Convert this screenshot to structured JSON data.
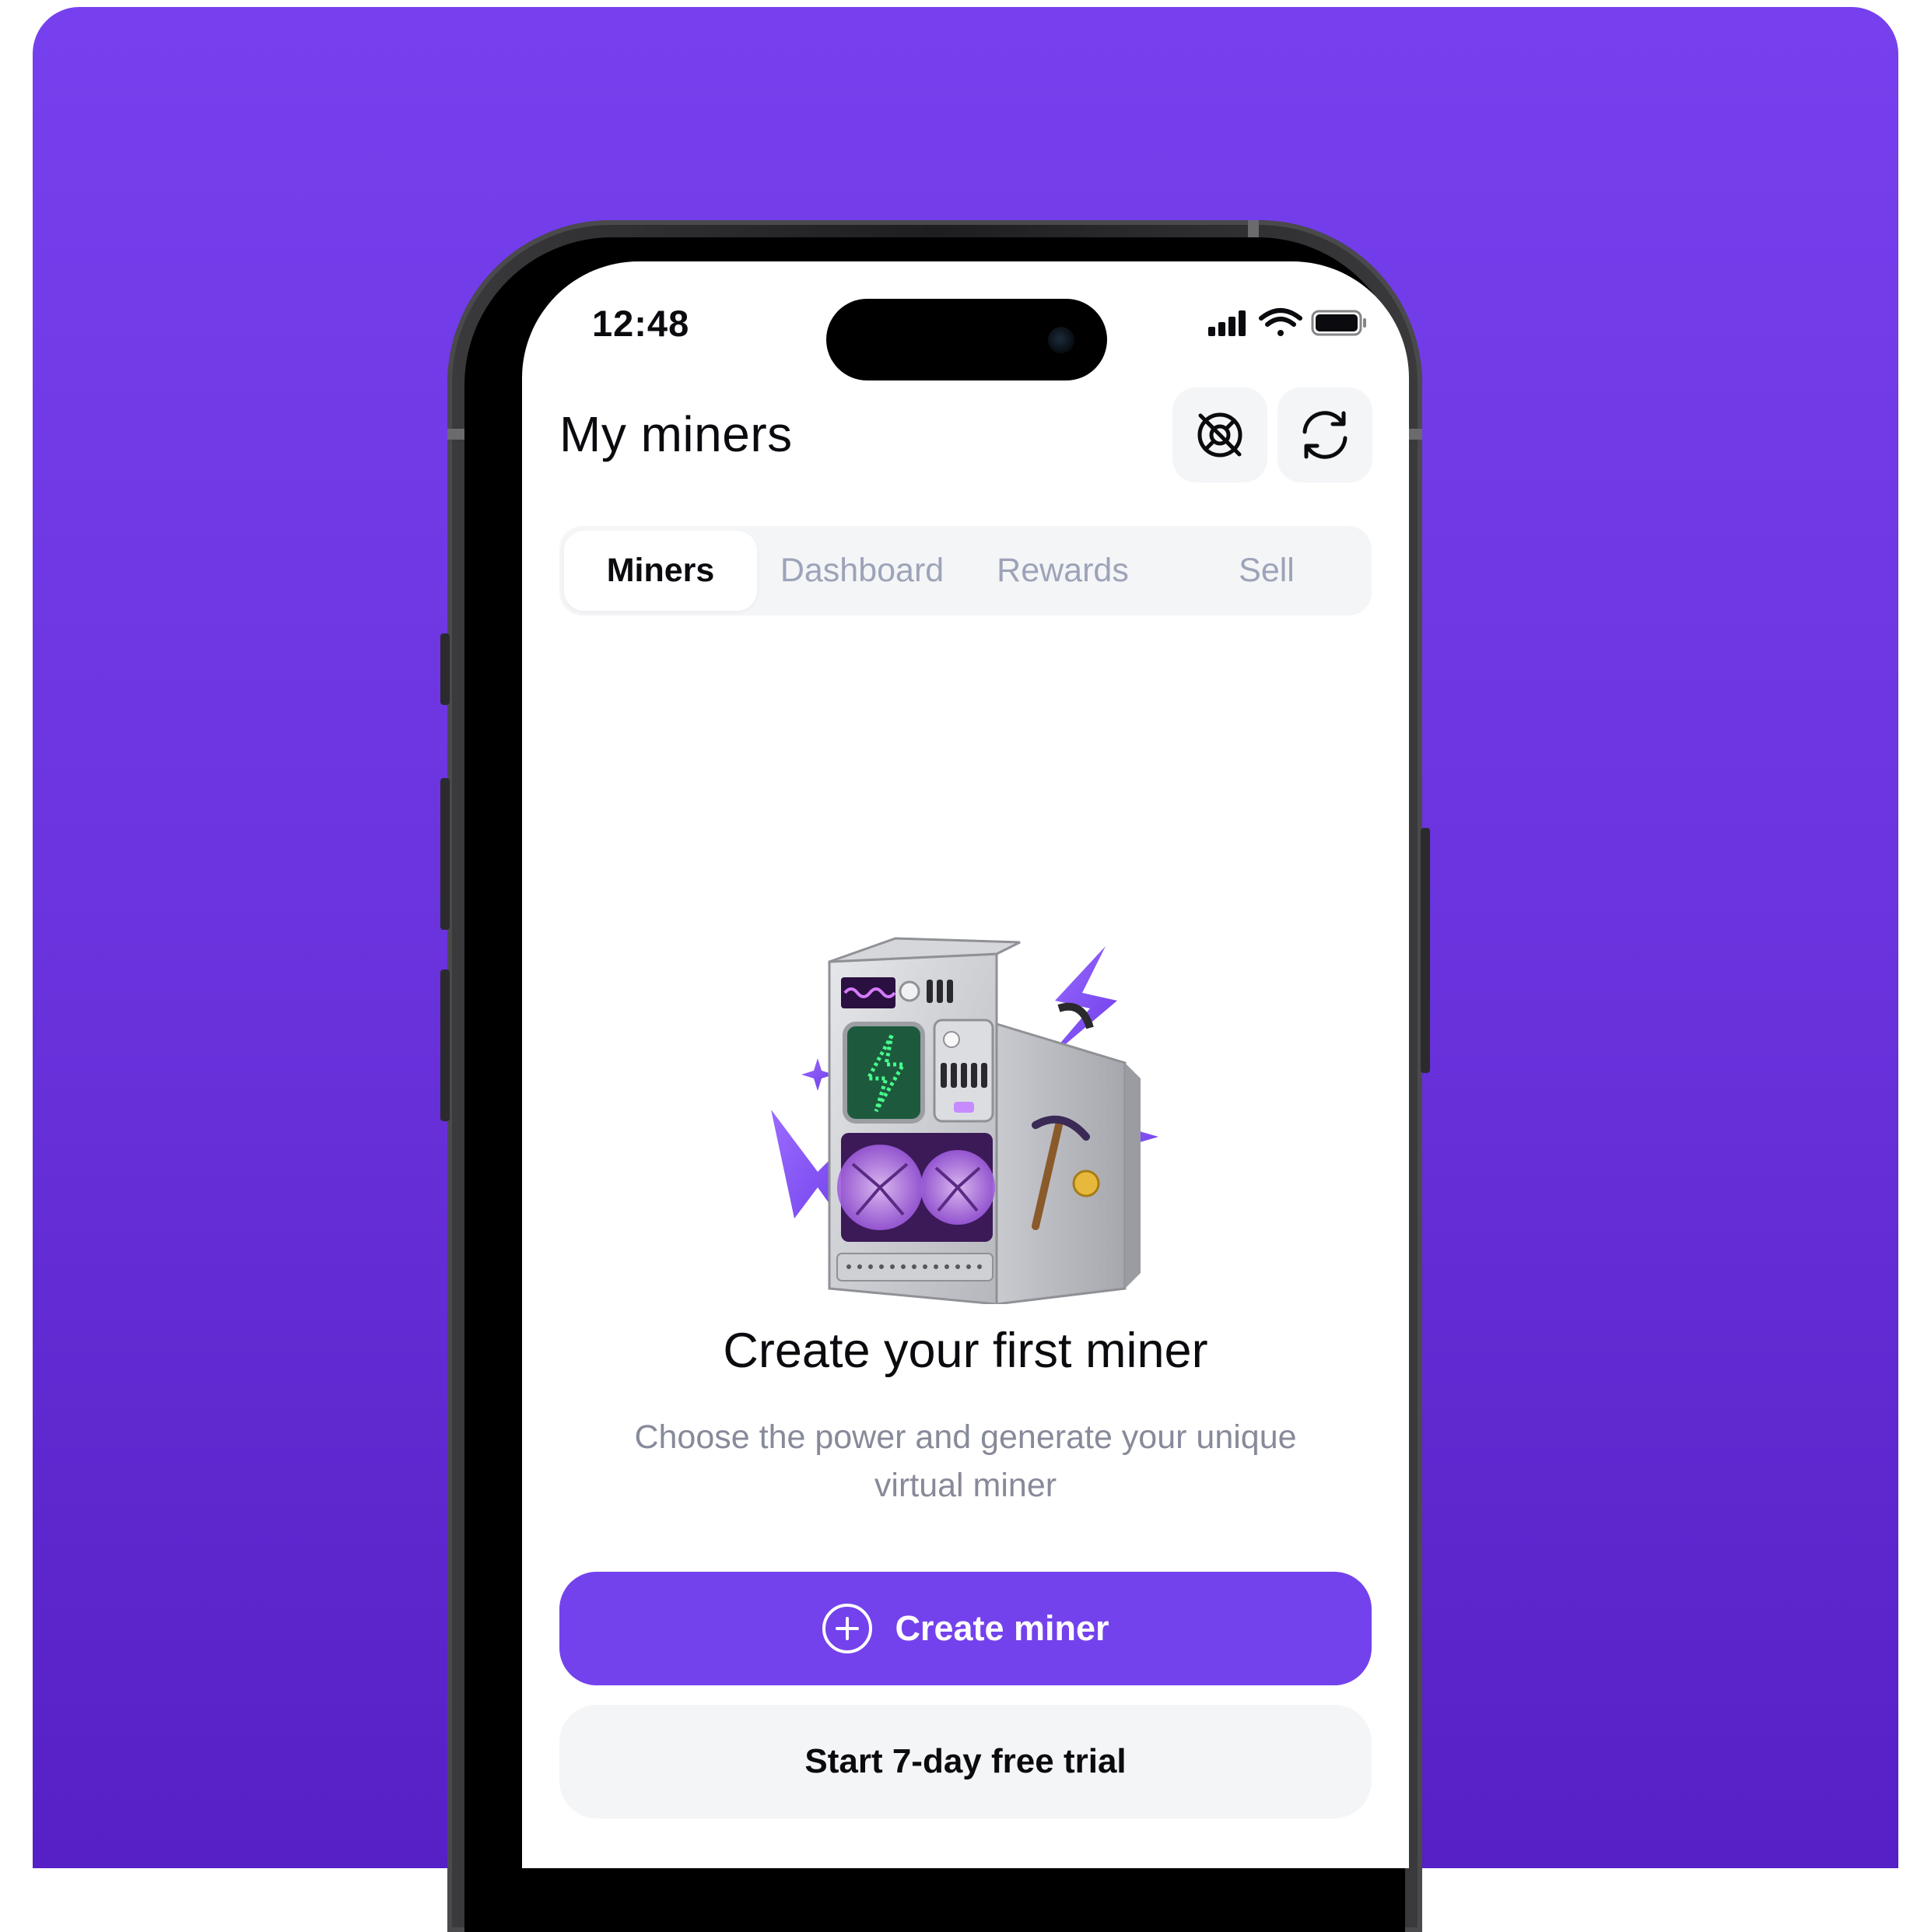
{
  "status_bar": {
    "time": "12:48"
  },
  "header": {
    "title": "My miners",
    "actions": [
      {
        "icon": "support-lifebuoy-icon"
      },
      {
        "icon": "refresh-icon"
      }
    ]
  },
  "tabs": [
    {
      "label": "Miners",
      "active": true
    },
    {
      "label": "Dashboard",
      "active": false
    },
    {
      "label": "Rewards",
      "active": false
    },
    {
      "label": "Sell",
      "active": false
    }
  ],
  "empty_state": {
    "title": "Create your first miner",
    "description": "Choose the power and generate your unique virtual miner"
  },
  "buttons": {
    "create_miner": "Create miner",
    "free_trial": "Start 7-day free trial"
  },
  "colors": {
    "background": "#7640ee",
    "accent": "#7442ec",
    "muted_text": "#878a99",
    "surface": "#f4f5f7"
  }
}
